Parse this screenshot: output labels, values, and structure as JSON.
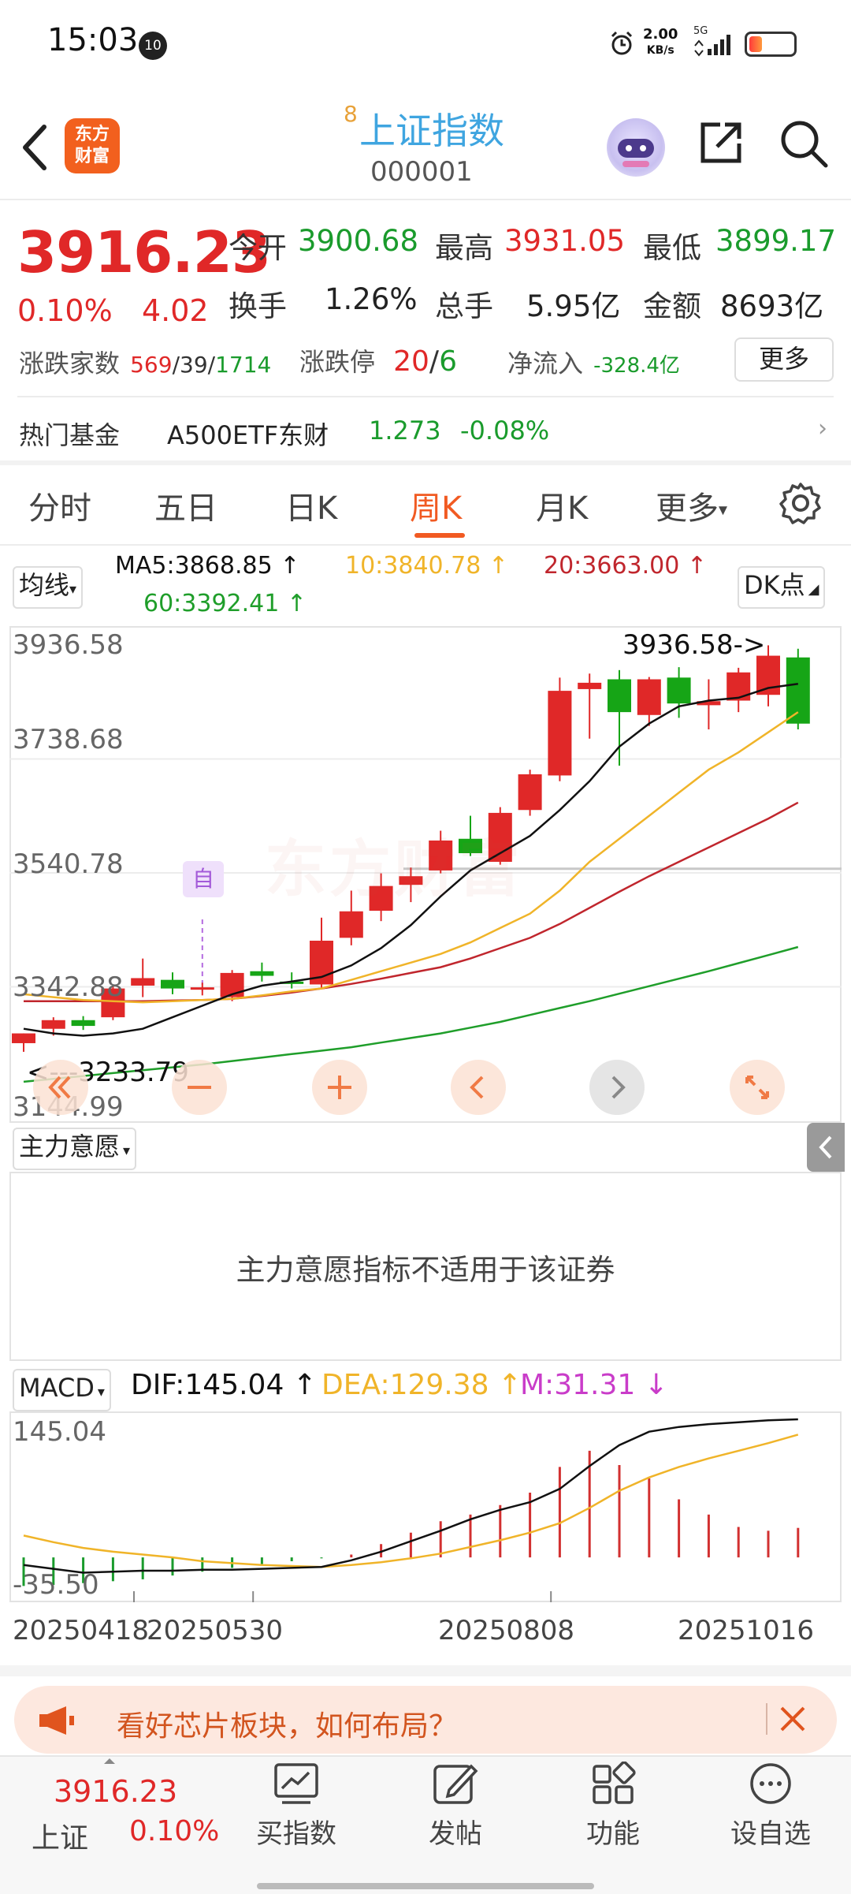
{
  "status_bar": {
    "time": "15:03",
    "badge": "10",
    "net_speed_value": "2.00",
    "net_speed_unit": "KB/s",
    "network": "5G",
    "battery_level": 0.3
  },
  "header": {
    "logo_text_line1": "东方",
    "logo_text_line2": "财富",
    "title_superscript": "8",
    "title": "上证指数",
    "code": "000001"
  },
  "quote": {
    "price": "3916.23",
    "change_pct": "0.10%",
    "change": "4.02",
    "open_label": "今开",
    "open": "3900.68",
    "high_label": "最高",
    "high": "3931.05",
    "low_label": "最低",
    "low": "3899.17",
    "turnover_label": "换手",
    "turnover": "1.26%",
    "volume_label": "总手",
    "volume": "5.95亿",
    "amount_label": "金额",
    "amount": "8693亿",
    "breadth_label": "涨跌家数",
    "breadth_up": "569",
    "breadth_flat": "39",
    "breadth_down": "1714",
    "breadth_sep1": "/",
    "breadth_sep2": "/",
    "limit_label": "涨跌停",
    "limit_up": "20",
    "limit_sep": "/",
    "limit_down": "6",
    "netflow_label": "净流入",
    "netflow": "-328.4亿",
    "more_label": "更多"
  },
  "hot_fund": {
    "label": "热门基金",
    "name": "A500ETF东财",
    "price": "1.273",
    "change_pct": "-0.08%"
  },
  "tabs": {
    "items": [
      "分时",
      "五日",
      "日K",
      "周K",
      "月K",
      "更多"
    ],
    "active": "周K"
  },
  "kline": {
    "ma_selector": "均线",
    "ma5": "MA5:3868.85 ↑",
    "ma10": "10:3840.78 ↑",
    "ma20": "20:3663.00 ↑",
    "ma60": "60:3392.41 ↑",
    "dk_selector": "DK点",
    "y_labels": [
      "3936.58",
      "3738.68",
      "3540.78",
      "3342.88",
      "3144.99"
    ],
    "max_label": "3936.58->",
    "min_label": "<---3233.79",
    "marker_text": "自",
    "watermark": "东方财富",
    "colors": {
      "up": "#e02828",
      "down": "#16a516",
      "ma5": "#111111",
      "ma10": "#f0b429",
      "ma20": "#c0262d",
      "ma60": "#1f9e2a"
    }
  },
  "main_force": {
    "selector": "主力意愿",
    "message": "主力意愿指标不适用于该证券"
  },
  "macd": {
    "selector": "MACD",
    "dif": "DIF:145.04 ↑",
    "dea": "DEA:129.38 ↑",
    "m": "M:31.31 ↓",
    "y_top": "145.04",
    "y_bottom": "-35.50",
    "dates": [
      "20250418",
      "20250530",
      "20250808",
      "20251016"
    ]
  },
  "chart_data": [
    {
      "type": "candlestick",
      "title": "",
      "ylim": [
        3144.99,
        3936.58
      ],
      "candles": [
        {
          "o": 3245,
          "h": 3262,
          "l": 3230,
          "c": 3262
        },
        {
          "o": 3270,
          "h": 3290,
          "l": 3258,
          "c": 3285
        },
        {
          "o": 3285,
          "h": 3292,
          "l": 3268,
          "c": 3275
        },
        {
          "o": 3290,
          "h": 3345,
          "l": 3285,
          "c": 3340
        },
        {
          "o": 3345,
          "h": 3392,
          "l": 3325,
          "c": 3358
        },
        {
          "o": 3355,
          "h": 3368,
          "l": 3330,
          "c": 3340
        },
        {
          "o": 3342,
          "h": 3350,
          "l": 3328,
          "c": 3342
        },
        {
          "o": 3325,
          "h": 3372,
          "l": 3318,
          "c": 3367
        },
        {
          "o": 3370,
          "h": 3385,
          "l": 3352,
          "c": 3362
        },
        {
          "o": 3352,
          "h": 3368,
          "l": 3340,
          "c": 3350
        },
        {
          "o": 3347,
          "h": 3463,
          "l": 3340,
          "c": 3423
        },
        {
          "o": 3428,
          "h": 3510,
          "l": 3415,
          "c": 3474
        },
        {
          "o": 3475,
          "h": 3540,
          "l": 3457,
          "c": 3518
        },
        {
          "o": 3520,
          "h": 3550,
          "l": 3490,
          "c": 3535
        },
        {
          "o": 3545,
          "h": 3614,
          "l": 3540,
          "c": 3597
        },
        {
          "o": 3600,
          "h": 3640,
          "l": 3570,
          "c": 3575
        },
        {
          "o": 3560,
          "h": 3655,
          "l": 3555,
          "c": 3645
        },
        {
          "o": 3650,
          "h": 3720,
          "l": 3640,
          "c": 3712
        },
        {
          "o": 3710,
          "h": 3880,
          "l": 3700,
          "c": 3857
        },
        {
          "o": 3860,
          "h": 3887,
          "l": 3774,
          "c": 3871
        },
        {
          "o": 3877,
          "h": 3893,
          "l": 3727,
          "c": 3820
        },
        {
          "o": 3815,
          "h": 3881,
          "l": 3796,
          "c": 3877
        },
        {
          "o": 3880,
          "h": 3898,
          "l": 3810,
          "c": 3835
        },
        {
          "o": 3832,
          "h": 3877,
          "l": 3790,
          "c": 3839
        },
        {
          "o": 3840,
          "h": 3897,
          "l": 3820,
          "c": 3889
        },
        {
          "o": 3850,
          "h": 3936,
          "l": 3830,
          "c": 3918
        },
        {
          "o": 3915,
          "h": 3930,
          "l": 3790,
          "c": 3800
        }
      ],
      "ma5": [
        3270,
        3262,
        3258,
        3262,
        3270,
        3290,
        3310,
        3330,
        3345,
        3352,
        3360,
        3380,
        3410,
        3450,
        3500,
        3545,
        3575,
        3605,
        3650,
        3700,
        3760,
        3800,
        3830,
        3840,
        3845,
        3862,
        3869
      ],
      "ma10": [
        3330,
        3325,
        3320,
        3318,
        3316,
        3318,
        3320,
        3322,
        3328,
        3335,
        3340,
        3355,
        3370,
        3385,
        3400,
        3420,
        3445,
        3470,
        3510,
        3560,
        3600,
        3640,
        3680,
        3720,
        3750,
        3785,
        3820
      ],
      "ma20": [
        3318,
        3318,
        3318,
        3318,
        3318,
        3319,
        3320,
        3322,
        3327,
        3333,
        3340,
        3348,
        3357,
        3367,
        3377,
        3392,
        3410,
        3428,
        3452,
        3480,
        3508,
        3535,
        3560,
        3585,
        3610,
        3635,
        3663
      ],
      "ma60": [
        3178,
        3183,
        3188,
        3193,
        3198,
        3203,
        3208,
        3214,
        3220,
        3226,
        3232,
        3238,
        3246,
        3254,
        3262,
        3272,
        3282,
        3294,
        3306,
        3318,
        3331,
        3344,
        3357,
        3370,
        3384,
        3398,
        3412
      ]
    },
    {
      "type": "bar",
      "title": "MACD",
      "ylim": [
        -35.5,
        145.04
      ],
      "dif": [
        -8,
        -12,
        -16,
        -15,
        -14,
        -14,
        -13,
        -13,
        -12,
        -11,
        -10,
        -3,
        6,
        17,
        28,
        40,
        50,
        58,
        72,
        96,
        118,
        132,
        137,
        140,
        142,
        144,
        145
      ],
      "dea": [
        23,
        16,
        10,
        6,
        3,
        0,
        -4,
        -6,
        -8,
        -9,
        -10,
        -8,
        -5,
        -1,
        4,
        11,
        18,
        26,
        36,
        52,
        70,
        84,
        95,
        104,
        112,
        120,
        129
      ],
      "m": [
        -30,
        -29,
        -27,
        -25,
        -23,
        -19,
        -15,
        -11,
        -7,
        -4,
        -1,
        3,
        14,
        26,
        38,
        45,
        55,
        68,
        95,
        112,
        97,
        83,
        61,
        45,
        32,
        28,
        31
      ]
    }
  ],
  "banner": {
    "text": "看好芯片板块，如何布局？"
  },
  "bottom_bar": {
    "index_price": "3916.23",
    "index_name": "上证",
    "index_pct": "0.10%",
    "items": [
      "买指数",
      "发帖",
      "功能",
      "设自选"
    ]
  }
}
